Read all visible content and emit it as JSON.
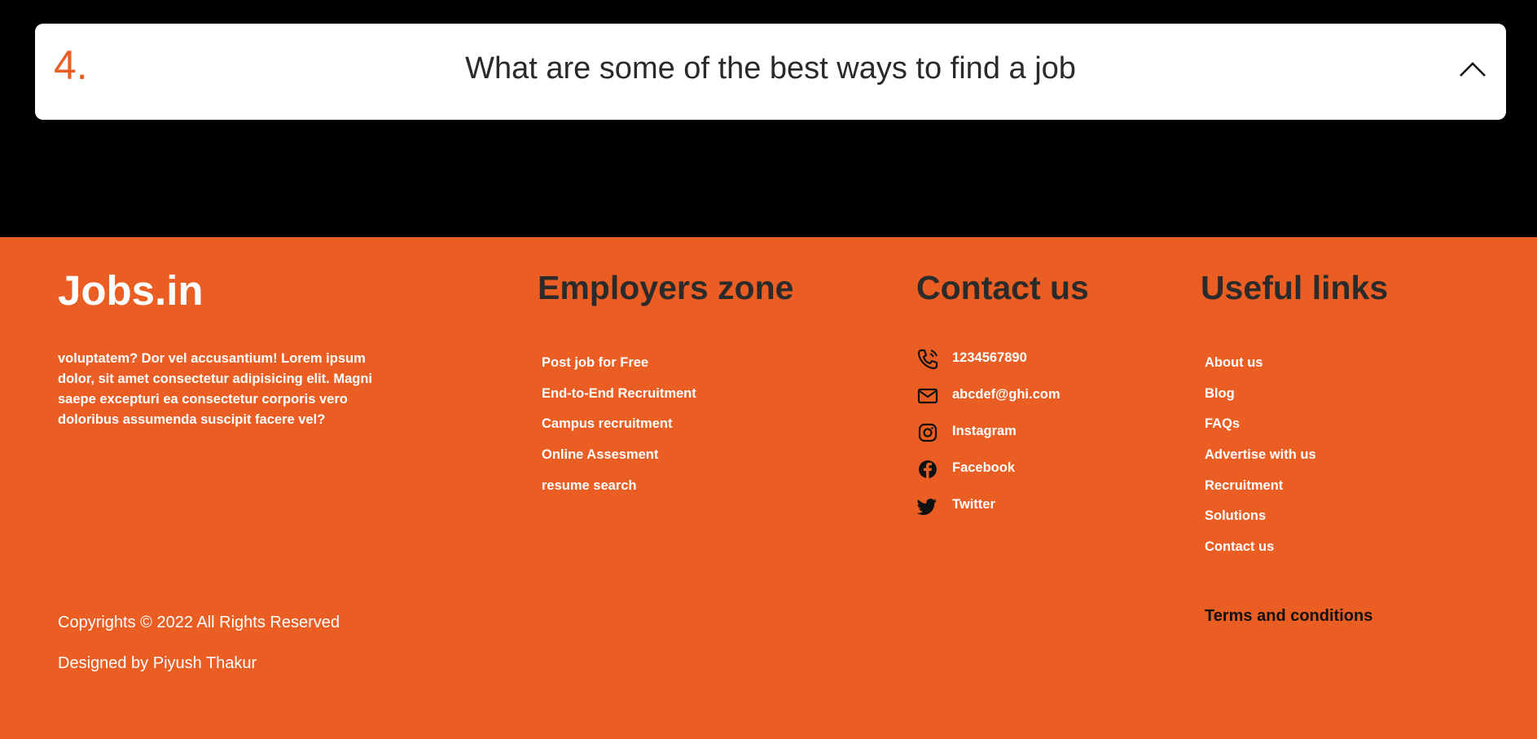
{
  "faq": {
    "number": "4.",
    "question": "What are some of the best ways to find a job",
    "toggle_icon": "chevron-up-icon"
  },
  "footer": {
    "brand": "Jobs.in",
    "about": "voluptatem? Dor vel accusantium! Lorem ipsum dolor, sit amet consectetur adipisicing elit. Magni saepe excepturi ea consectetur corporis vero doloribus assumenda suscipit facere vel?",
    "employers": {
      "heading": "Employers zone",
      "items": [
        "Post job for Free",
        "End-to-End Recruitment",
        "Campus recruitment",
        "Online Assesment",
        "resume search"
      ]
    },
    "contact": {
      "heading": "Contact us",
      "items": [
        {
          "icon": "phone-icon",
          "label": "1234567890"
        },
        {
          "icon": "mail-icon",
          "label": "abcdef@ghi.com"
        },
        {
          "icon": "instagram-icon",
          "label": "Instagram"
        },
        {
          "icon": "facebook-icon",
          "label": "Facebook"
        },
        {
          "icon": "twitter-icon",
          "label": "Twitter"
        }
      ]
    },
    "useful": {
      "heading": "Useful links",
      "items": [
        "About us",
        "Blog",
        "FAQs",
        "Advertise with us",
        "Recruitment",
        "Solutions",
        "Contact us"
      ]
    },
    "copyright": "Copyrights © 2022 All Rights Reserved",
    "designed_by": "Designed by Piyush Thakur",
    "terms": "Terms and conditions"
  },
  "colors": {
    "accent": "#eb5e23",
    "page_background": "#000000",
    "heading_text": "#2b2b2b",
    "link_text": "#ffffff"
  }
}
